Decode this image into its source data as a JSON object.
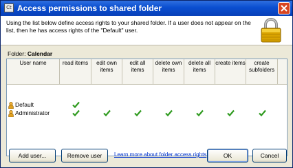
{
  "window": {
    "title": "Access permissions to shared folder",
    "app_icon_text": "Ct",
    "close_icon": "close-icon",
    "instructions": "Using the list below define access rights to your shared folder. If a user does not appear on the list, then he has access rights of the \"Default\" user.",
    "lock_icon": "padlock-icon"
  },
  "folder": {
    "label": "Folder:",
    "name": "Calendar"
  },
  "grid": {
    "columns": [
      "User name",
      "read items",
      "edit own items",
      "edit all items",
      "delete own items",
      "delete all items",
      "create items",
      "create subfolders"
    ],
    "rows": [
      {
        "user": "Default",
        "checks": [
          true,
          false,
          false,
          false,
          false,
          false,
          false
        ]
      },
      {
        "user": "Administrator",
        "checks": [
          true,
          true,
          true,
          true,
          true,
          true,
          true
        ]
      }
    ],
    "check_color": "#2e9a1e"
  },
  "buttons": {
    "add_user": "Add user...",
    "remove_user": "Remove user",
    "learn_more": "Learn more about folder access rights",
    "ok": "OK",
    "cancel": "Cancel"
  }
}
